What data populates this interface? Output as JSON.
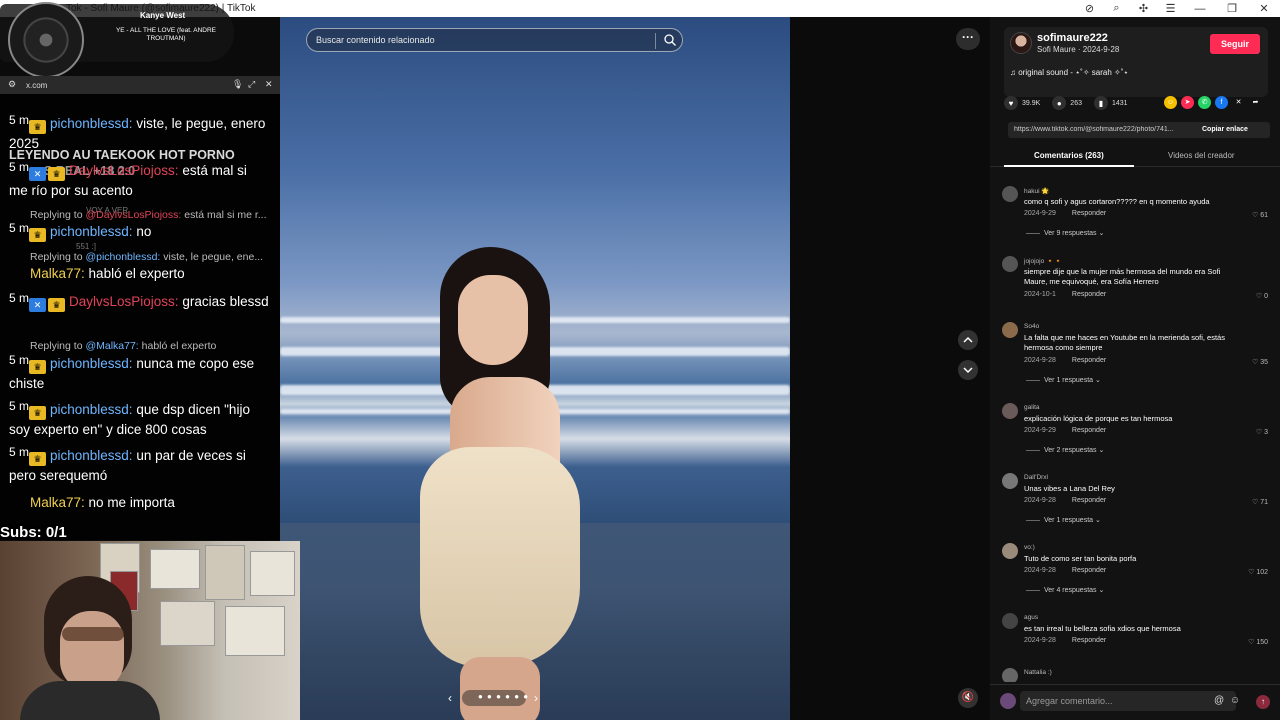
{
  "browser": {
    "title": "Tok - Sofi Maure (@sofimaure222) | TikTok"
  },
  "search": {
    "placeholder": "Buscar contenido relacionado"
  },
  "post": {
    "username": "sofimaure222",
    "subline": "Sofi Maure · 2024-9-28",
    "follow_label": "Seguir",
    "sound": "original sound - ⋆˚✧ sarah ✧˚⋆",
    "likes": "39.9K",
    "comments": "263",
    "saves": "1431",
    "url": "https://www.tiktok.com/@sofimaure222/photo/741...",
    "copy_label": "Copiar enlace"
  },
  "tabs": {
    "comments": "Comentarios (263)",
    "creator": "Videos del creador"
  },
  "comments": [
    {
      "user": "hakui 🌟",
      "text": "como q sofi y agus cortaron????? en q momento ayuda",
      "date": "2024-9-29",
      "reply": "Responder",
      "likes": "61",
      "more": "Ver 9 respuestas ⌄"
    },
    {
      "user": "jojojojo 🔸🔸",
      "text": "siempre dije que la mujer más hermosa del mundo era Sofi Maure, me equivoqué, era Sofía Herrero",
      "date": "2024-10-1",
      "reply": "Responder",
      "likes": "0",
      "more": ""
    },
    {
      "user": "So4o",
      "text": "La falta que me haces en Youtube en la merienda sofi, estás hermosa como siempre",
      "date": "2024-9-28",
      "reply": "Responder",
      "likes": "35",
      "more": "Ver 1 respuesta ⌄"
    },
    {
      "user": "galita",
      "text": "explicación lógica de porque es tan hermosa",
      "date": "2024-9-29",
      "reply": "Responder",
      "likes": "3",
      "more": "Ver 2 respuestas ⌄"
    },
    {
      "user": "Dall'Drxl",
      "text": "Unas vibes a Lana Del Rey",
      "date": "2024-9-28",
      "reply": "Responder",
      "likes": "71",
      "more": "Ver 1 respuesta ⌄"
    },
    {
      "user": "vo:)",
      "text": "Tuto de como ser tan bonita porfa",
      "date": "2024-9-28",
      "reply": "Responder",
      "likes": "102",
      "more": "Ver 4 respuestas ⌄"
    },
    {
      "user": "agus",
      "text": "es tan irreal tu belleza sofia xdios que hermosa",
      "date": "2024-9-28",
      "reply": "Responder",
      "likes": "150",
      "more": ""
    },
    {
      "user": "Nattalia :)",
      "text": "",
      "date": "",
      "reply": "",
      "likes": "",
      "more": ""
    }
  ],
  "add_comment": {
    "placeholder": "Agregar comentario..."
  },
  "music": {
    "artist": "Kanye West",
    "song": "YE - ALL THE LOVE (feat. ANDRE TROUTMAN)"
  },
  "chat": {
    "url": "x.com",
    "messages": [
      {
        "ts": "5 m",
        "user": "pichonblessd:",
        "text": "viste, le pegue, enero 2025"
      },
      {
        "ts": "5 m",
        "user": "DaylvsLosPiojoss:",
        "text": "está mal si me río por su acento"
      },
      {
        "ts": "5 m",
        "user": "pichonblessd:",
        "text": "no"
      },
      {
        "ts": "5 m",
        "user": "Malka77:",
        "text": "habló el experto"
      },
      {
        "ts": "5 m",
        "user": "DaylvsLosPiojoss:",
        "text": "gracias blessd"
      },
      {
        "ts": "5 m",
        "user": "pichonblessd:",
        "text": "nunca me copo ese chiste"
      },
      {
        "ts": "5 m",
        "user": "pichonblessd:",
        "text": "que dsp dicen \"hijo soy experto en\" y dice 800 cosas"
      },
      {
        "ts": "5 m",
        "user": "pichonblessd:",
        "text": "un par de veces si pero serequemó"
      },
      {
        "ts": "5 m",
        "user": "Malka77:",
        "text": "no me importa"
      }
    ],
    "replies": [
      {
        "to": "@DaylvsLosPiojoss:",
        "text": "está mal si me r..."
      },
      {
        "to": "@pichonblessd:",
        "text": "viste, le pegue, ene..."
      },
      {
        "to": "@Malka77:",
        "text": "habló el experto"
      }
    ],
    "reply_prefix": "Replying to",
    "ghost_title": "LEYENDO AU TAEKOOK HOT PORNO",
    "ghost_sub": "S REAL +18 2.0",
    "ghost_vote": "VOY A VER",
    "ghost_count": "551 :]"
  },
  "subs_label": "Subs: 0/1",
  "colors": {
    "accent": "#fe2c55",
    "panel_bg": "#121212"
  }
}
